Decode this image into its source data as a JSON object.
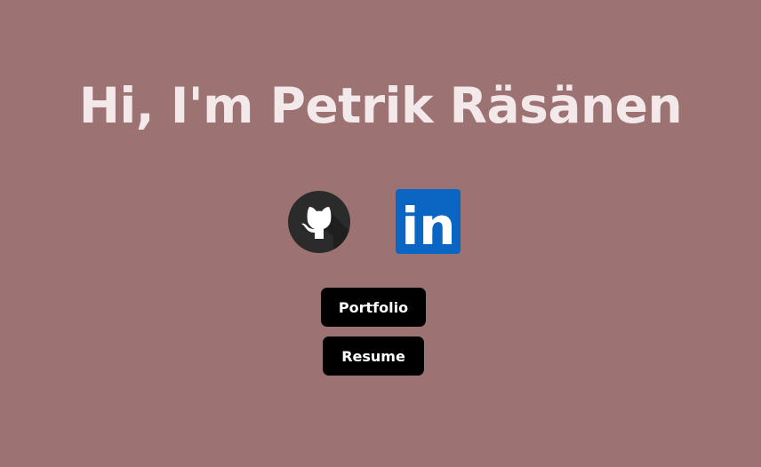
{
  "page": {
    "heading": "Hi, I'm Petrik Räsänen",
    "background_color": "#9d7272",
    "heading_color": "#f3e8ea"
  },
  "social": {
    "github": {
      "icon": "github-icon"
    },
    "linkedin": {
      "icon": "linkedin-icon",
      "text": "in",
      "color": "#0a66c2"
    }
  },
  "buttons": {
    "portfolio_label": "Portfolio",
    "resume_label": "Resume"
  }
}
